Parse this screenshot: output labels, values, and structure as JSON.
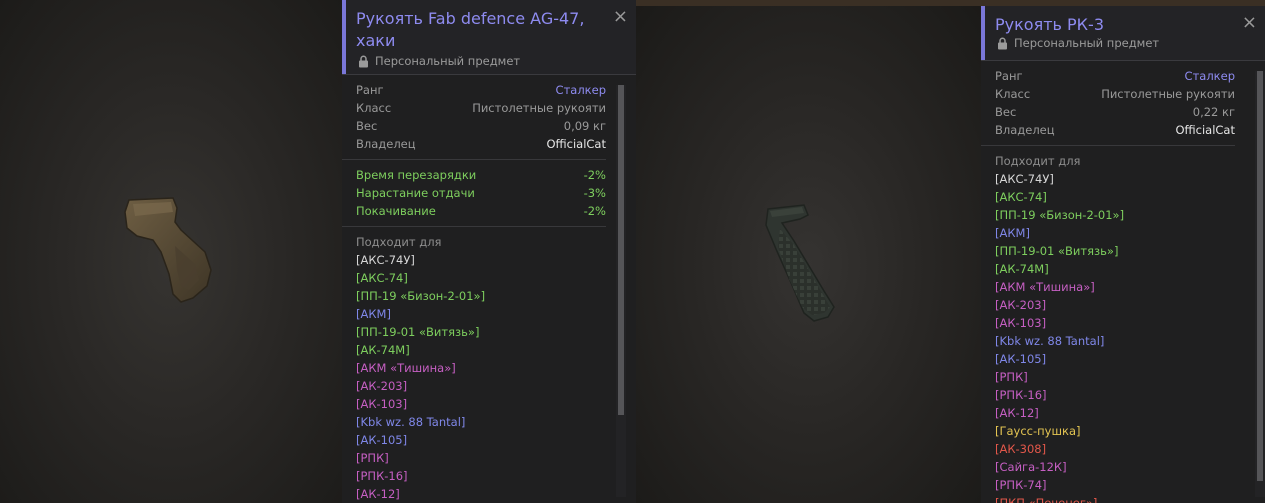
{
  "left_card": {
    "title": "Рукоять Fab defence AG-47, хаки",
    "personal": "Персональный предмет",
    "close": "×",
    "props": [
      {
        "k": "Ранг",
        "v": "Сталкер"
      },
      {
        "k": "Класс",
        "v": "Пистолетные рукояти"
      },
      {
        "k": "Вес",
        "v": "0,09 кг"
      },
      {
        "k": "Владелец",
        "v": "OfficialCat"
      }
    ],
    "stats": [
      {
        "k": "Время перезарядки",
        "v": "-2%"
      },
      {
        "k": "Нарастание отдачи",
        "v": "-3%"
      },
      {
        "k": "Покачивание",
        "v": "-2%"
      }
    ],
    "fits_label": "Подходит для",
    "fits": [
      "[АКС-74У]",
      "[АКС-74]",
      "[ПП-19 «Бизон-2-01»]",
      "[АКМ]",
      "[ПП-19-01 «Витязь»]",
      "[АК-74М]",
      "[АКМ «Тишина»]",
      "[АК-203]",
      "[АК-103]",
      "[Kbk wz. 88 Tantal]",
      "[АК-105]",
      "[РПК]",
      "[РПК-16]",
      "[АК-12]"
    ]
  },
  "right_card": {
    "title": "Рукоять РК-3",
    "personal": "Персональный предмет",
    "close": "×",
    "props": [
      {
        "k": "Ранг",
        "v": "Сталкер"
      },
      {
        "k": "Класс",
        "v": "Пистолетные рукояти"
      },
      {
        "k": "Вес",
        "v": "0,22 кг"
      },
      {
        "k": "Владелец",
        "v": "OfficialCat"
      }
    ],
    "fits_label": "Подходит для",
    "fits": [
      "[АКС-74У]",
      "[АКС-74]",
      "[ПП-19 «Бизон-2-01»]",
      "[АКМ]",
      "[ПП-19-01 «Витязь»]",
      "[АК-74М]",
      "[АКМ «Тишина»]",
      "[АК-203]",
      "[АК-103]",
      "[Kbk wz. 88 Tantal]",
      "[АК-105]",
      "[РПК]",
      "[РПК-16]",
      "[АК-12]",
      "[Гаусс-пушка]",
      "[АК-308]",
      "[Сайга-12К]",
      "[РПК-74]",
      "[ПКП «Печенег»]"
    ]
  },
  "colors": {
    "accent": "#7a77d8",
    "title": "#8e8bf0",
    "stat_green": "#7ecf5e",
    "rank_blue": "#8e8bf0"
  }
}
